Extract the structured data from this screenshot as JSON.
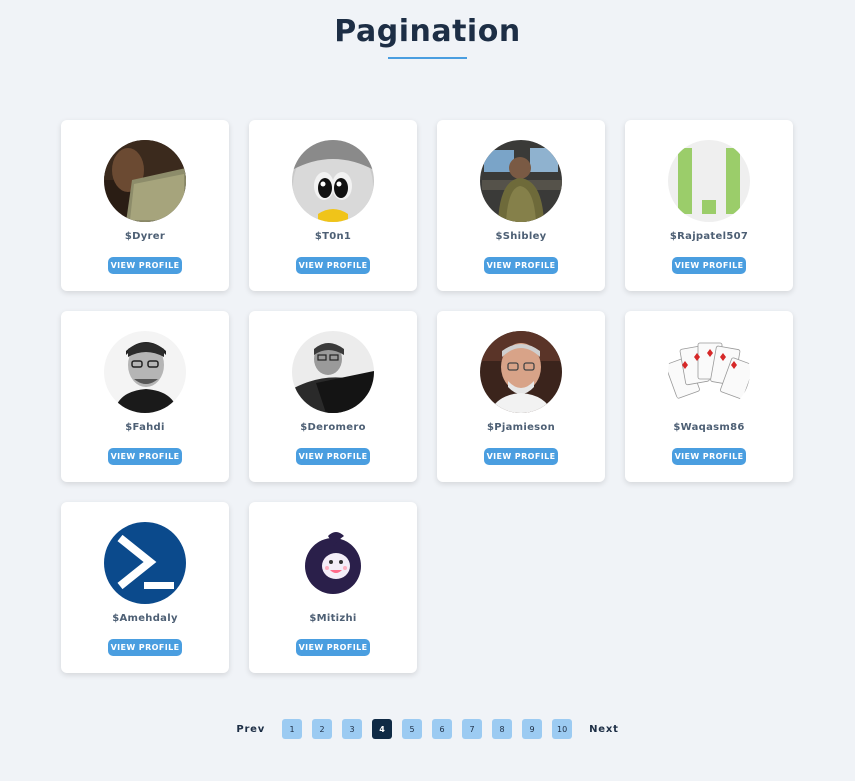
{
  "header": {
    "title": "Pagination"
  },
  "profiles": [
    {
      "username": "$Dyrer",
      "button": "VIEW PROFILE",
      "avatar": "dyrer-avatar"
    },
    {
      "username": "$T0n1",
      "button": "VIEW PROFILE",
      "avatar": "penguin-avatar"
    },
    {
      "username": "$Shibley",
      "button": "VIEW PROFILE",
      "avatar": "shibley-avatar"
    },
    {
      "username": "$Rajpatel507",
      "button": "VIEW PROFILE",
      "avatar": "identicon-avatar"
    },
    {
      "username": "$Fahdi",
      "button": "VIEW PROFILE",
      "avatar": "fahdi-avatar"
    },
    {
      "username": "$Deromero",
      "button": "VIEW PROFILE",
      "avatar": "deromero-avatar"
    },
    {
      "username": "$Pjamieson",
      "button": "VIEW PROFILE",
      "avatar": "pjamieson-avatar"
    },
    {
      "username": "$Waqasm86",
      "button": "VIEW PROFILE",
      "avatar": "cards-avatar"
    },
    {
      "username": "$Amehdaly",
      "button": "VIEW PROFILE",
      "avatar": "powershell-avatar"
    },
    {
      "username": "$Mitizhi",
      "button": "VIEW PROFILE",
      "avatar": "mitizhi-avatar"
    }
  ],
  "pagination": {
    "prev": "Prev",
    "next": "Next",
    "pages": [
      "1",
      "2",
      "3",
      "4",
      "5",
      "6",
      "7",
      "8",
      "9",
      "10"
    ],
    "current": "4"
  },
  "colors": {
    "accent": "#4a9ee0",
    "page_bg": "#9ccbf2",
    "active_page": "#0f2a45",
    "title": "#1d2e45"
  }
}
